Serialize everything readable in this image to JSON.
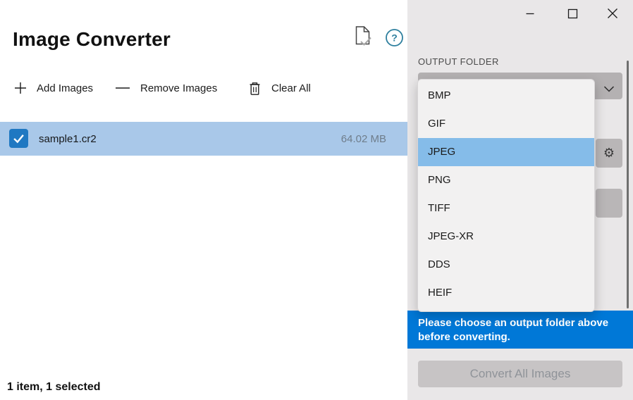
{
  "app_title": "Image Converter",
  "toolbar": {
    "add_label": "Add Images",
    "remove_label": "Remove Images",
    "clear_label": "Clear All"
  },
  "files": [
    {
      "name": "sample1.cr2",
      "size": "64.02 MB",
      "selected": true
    }
  ],
  "status_text": "1 item, 1 selected",
  "panel": {
    "output_folder_label": "OUTPUT FOLDER",
    "format_options": [
      "BMP",
      "GIF",
      "JPEG",
      "PNG",
      "TIFF",
      "JPEG-XR",
      "DDS",
      "HEIF"
    ],
    "selected_format": "JPEG",
    "notice": {
      "line1": "Please choose an output folder above",
      "line2": "before converting."
    },
    "convert_button_label": "Convert All Images",
    "convert_enabled": false
  },
  "icons": {
    "gear_glyph": "⚙",
    "help_glyph": "?"
  },
  "colors": {
    "accent_blue": "#0078d7",
    "row_selection": "#a9c8e9",
    "dropdown_highlight": "#85bce9",
    "checkbox_blue": "#1f78c2",
    "help_icon_teal": "#2e7f9e",
    "panel_gray": "#e9e7e8"
  }
}
